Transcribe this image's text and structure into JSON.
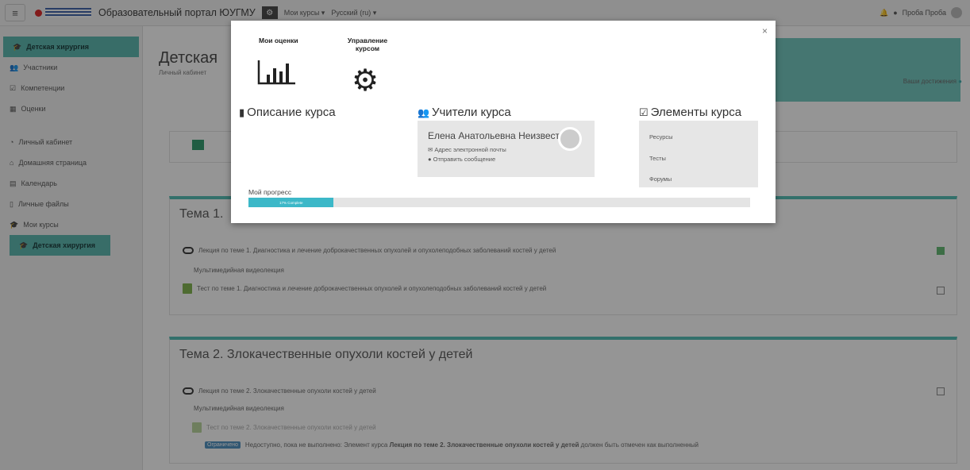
{
  "navbar": {
    "portal_title": "Образовательный портал ЮУГМУ",
    "my_courses": "Мои курсы ▾",
    "language": "Русский (ru) ▾",
    "user_name": "Проба Проба"
  },
  "sidebar": {
    "items": [
      {
        "label": "Детская хирургия",
        "active": true
      },
      {
        "label": "Участники"
      },
      {
        "label": "Компетенции"
      },
      {
        "label": "Оценки"
      },
      {
        "label": "Личный кабинет"
      },
      {
        "label": "Домашняя страница"
      },
      {
        "label": "Календарь"
      },
      {
        "label": "Личные файлы"
      },
      {
        "label": "Мои курсы"
      },
      {
        "label": "Детская хирургия",
        "active": true
      }
    ]
  },
  "header": {
    "course_title": "Детская",
    "breadcrumb": "Личный кабинет",
    "achievements": "Ваши достижения"
  },
  "topics": [
    {
      "title": "Тема 1.",
      "lecture": "Лекция по теме 1. Диагностика и лечение доброкачественных опухолей и опухолеподобных заболеваний костей у детей",
      "lecture_sub": "Мультимедийная видеолекция",
      "quiz": "Тест по теме 1. Диагностика и лечение доброкачественных опухолей и опухолеподобных заболеваний костей у детей"
    },
    {
      "title": "Тема 2. Злокачественные опухоли костей у детей",
      "lecture": "Лекция по теме 2. Злокачественные опухоли костей у детей",
      "lecture_sub": "Мультимедийная видеолекция",
      "quiz": "Тест по теме 2. Злокачественные опухоли костей у детей",
      "restricted_badge": "Ограничено",
      "restriction_prefix": "Недоступно, пока не выполнено: Элемент курса ",
      "restriction_bold": "Лекция по теме 2. Злокачественные опухоли костей у детей",
      "restriction_suffix": " должен быть отмечен как выполненный"
    }
  ],
  "modal": {
    "close": "×",
    "my_grades": "Мои оценки",
    "course_admin_line1": "Управление",
    "course_admin_line2": "курсом",
    "description_head": "Описание курса",
    "teachers_head": "Учители курса",
    "elements_head": "Элементы курса",
    "teacher_name": "Елена Анатольевна Неизвестных",
    "teacher_email": "Адрес электронной почты",
    "teacher_message": "Отправить сообщение",
    "elements": [
      "Ресурсы",
      "Тесты",
      "Форумы"
    ],
    "progress_label": "Мой прогресс",
    "progress_text": "17% Complete",
    "progress_value": 0.17
  },
  "icons": [
    "hamburger-icon",
    "gear-icon",
    "bell-icon",
    "chat-icon",
    "bar-chart-icon",
    "map-icon",
    "users-icon",
    "checkbox-icon",
    "envelope-icon",
    "comment-icon",
    "link-icon",
    "quiz-icon",
    "close-icon"
  ],
  "colors": {
    "accent": "#4dbcb2",
    "progress": "#3cb8c8",
    "header": "#6ec6be"
  }
}
